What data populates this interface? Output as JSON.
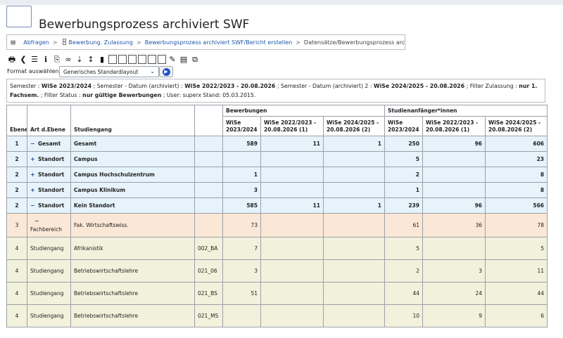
{
  "page": {
    "title": "Bewerbungsprozess archiviert SWF"
  },
  "breadcrumb": {
    "items": [
      {
        "label": "Abfragen",
        "kind": "link"
      },
      {
        "label": "Bewerbung. Zulassung",
        "kind": "link"
      },
      {
        "label": "Bewerbungsprozess archiviert SWF/Bericht erstellen",
        "kind": "link"
      },
      {
        "label": "Datensätze/Bewerbungsprozess archiviert SWF",
        "kind": "current"
      }
    ],
    "separator": ">",
    "tag": "«"
  },
  "toolbar": {
    "icons": [
      "print-icon",
      "back-icon",
      "list-icon",
      "info-icon",
      "attachment-icon",
      "link-icon",
      "sort-down-icon",
      "sort-az-icon",
      "chart-icon",
      "export-icon",
      "export-csv-icon",
      "export-pdf-icon",
      "export-xls-icon",
      "export-xml-icon",
      "export-html-icon",
      "edit-icon",
      "table-icon",
      "copy-icon"
    ]
  },
  "format": {
    "label": "Format auswählen:",
    "selected": "Generisches Standardlayout"
  },
  "filters": [
    {
      "label": "Semester :",
      "value": "WiSe 2023/2024"
    },
    {
      "label": "; Semester - Datum (archiviert) :",
      "value": "WiSe 2022/2023 - 20.08.2026"
    },
    {
      "label": "; Semester - Datum (archiviert) 2 :",
      "value": "WiSe 2024/2025 - 20.08.2026"
    },
    {
      "label": "; Filter Zulassung :",
      "value": "nur 1. Fachsem."
    },
    {
      "label": "; Filter Status :",
      "value": "nur gültige Bewerbungen"
    },
    {
      "label": "; User: superx Stand: 05.03.2015.",
      "value": ""
    }
  ],
  "table": {
    "headers": {
      "ebene": "Ebene",
      "art": "Art d.Ebene",
      "studiengang": "Studiengang",
      "group_bewerbungen": "Bewerbungen",
      "group_anfaenger": "Studienanfänger*innen",
      "sub1": "WiSe 2023/2024",
      "sub2": "WiSe 2022/2023 - 20.08.2026 (1)",
      "sub3": "WiSe 2024/2025 - 20.08.2026 (2)",
      "sub4": "WiSe 2023/2024",
      "sub5": "WiSe 2022/2023 - 20.08.2026 (1)",
      "sub6": "WiSe 2024/2025 - 20.08.2026 (2)"
    },
    "rows": [
      {
        "ebene": "1",
        "toggle": "−",
        "art": "Gesamt",
        "studiengang": "Gesamt",
        "code": "",
        "b1": "589",
        "b2": "11",
        "b3": "1",
        "s1": "250",
        "s2": "96",
        "s3": "606",
        "level": 1
      },
      {
        "ebene": "2",
        "toggle": "+",
        "art": "Standort",
        "studiengang": "Campus",
        "code": "",
        "b1": "",
        "b2": "",
        "b3": "",
        "s1": "5",
        "s2": "",
        "s3": "23",
        "level": 2
      },
      {
        "ebene": "2",
        "toggle": "+",
        "art": "Standort",
        "studiengang": "Campus Hochschulzentrum",
        "code": "",
        "b1": "1",
        "b2": "",
        "b3": "",
        "s1": "2",
        "s2": "",
        "s3": "8",
        "level": 2
      },
      {
        "ebene": "2",
        "toggle": "+",
        "art": "Standort",
        "studiengang": "Campus Klinikum",
        "code": "",
        "b1": "3",
        "b2": "",
        "b3": "",
        "s1": "1",
        "s2": "",
        "s3": "8",
        "level": 2
      },
      {
        "ebene": "2",
        "toggle": "−",
        "art": "Standort",
        "studiengang": "Kein Standort",
        "code": "",
        "b1": "585",
        "b2": "11",
        "b3": "1",
        "s1": "239",
        "s2": "96",
        "s3": "566",
        "level": 2
      },
      {
        "ebene": "3",
        "toggle": "−",
        "art": "Fachbereich",
        "studiengang": "Fak. Wirtschaftswiss.",
        "code": "",
        "b1": "73",
        "b2": "",
        "b3": "",
        "s1": "61",
        "s2": "36",
        "s3": "78",
        "level": 3
      },
      {
        "ebene": "4",
        "toggle": "",
        "art": "Studiengang",
        "studiengang": "Afrikanistik",
        "code": "002_BA",
        "b1": "7",
        "b2": "",
        "b3": "",
        "s1": "5",
        "s2": "",
        "s3": "5",
        "level": 4
      },
      {
        "ebene": "4",
        "toggle": "",
        "art": "Studiengang",
        "studiengang": "Betriebswirtschaftslehre",
        "code": "021_06",
        "b1": "3",
        "b2": "",
        "b3": "",
        "s1": "2",
        "s2": "3",
        "s3": "11",
        "level": 4
      },
      {
        "ebene": "4",
        "toggle": "",
        "art": "Studiengang",
        "studiengang": "Betriebswirtschaftslehre",
        "code": "021_BS",
        "b1": "51",
        "b2": "",
        "b3": "",
        "s1": "44",
        "s2": "24",
        "s3": "44",
        "level": 4
      },
      {
        "ebene": "4",
        "toggle": "",
        "art": "Studiengang",
        "studiengang": "Betriebswirtschaftslehre",
        "code": "021_MS",
        "b1": "",
        "b2": "",
        "b3": "",
        "s1": "10",
        "s2": "9",
        "s3": "6",
        "level": 4
      }
    ]
  }
}
